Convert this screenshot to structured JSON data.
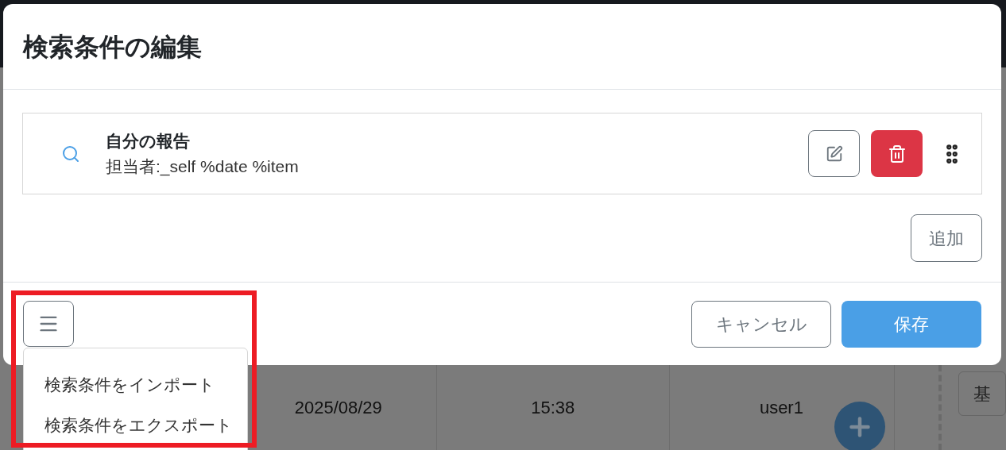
{
  "background": {
    "row": [
      "2025/08/29",
      "15:38",
      "user1"
    ],
    "side_button": "基"
  },
  "dialog": {
    "title": "検索条件の編集",
    "conditions": [
      {
        "name": "自分の報告",
        "query": "担当者:_self %date %item"
      }
    ],
    "add_button": "追加",
    "cancel_button": "キャンセル",
    "save_button": "保存",
    "menu": {
      "expanded": true,
      "items": [
        "検索条件をインポート",
        "検索条件をエクスポート"
      ]
    }
  }
}
